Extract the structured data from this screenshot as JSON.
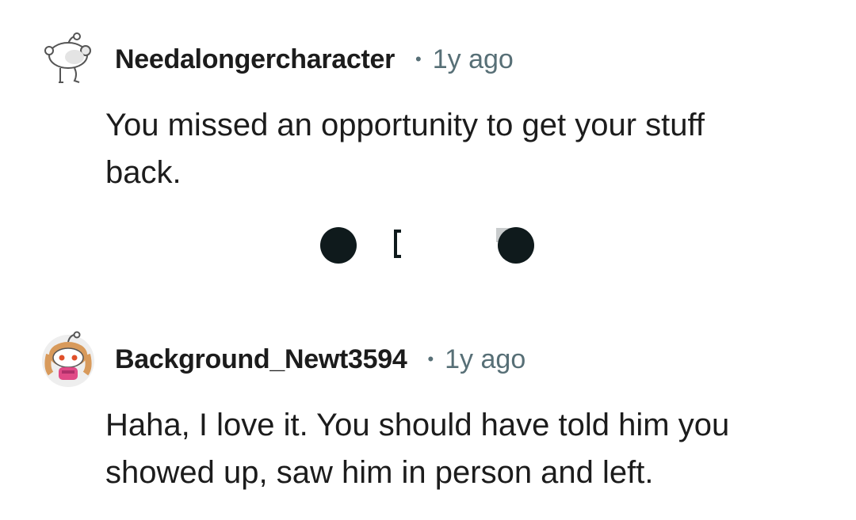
{
  "comments": [
    {
      "username": "Needalongercharacter",
      "separator": "•",
      "timestamp": "1y ago",
      "avatar_icon": "snoo-default-avatar-icon",
      "body_lines": [
        "You missed an opportunity to get your stuff",
        "back."
      ]
    },
    {
      "username": "Background_Newt3594",
      "separator": "•",
      "timestamp": "1y ago",
      "avatar_icon": "snoo-girl-avatar-icon",
      "body_lines": [
        "Haha, I love it. You should have told him you",
        "showed up, saw him in person and left."
      ]
    }
  ],
  "colors": {
    "text": "#1c1c1c",
    "meta": "#576f76",
    "dots": "#0f1a1c"
  }
}
